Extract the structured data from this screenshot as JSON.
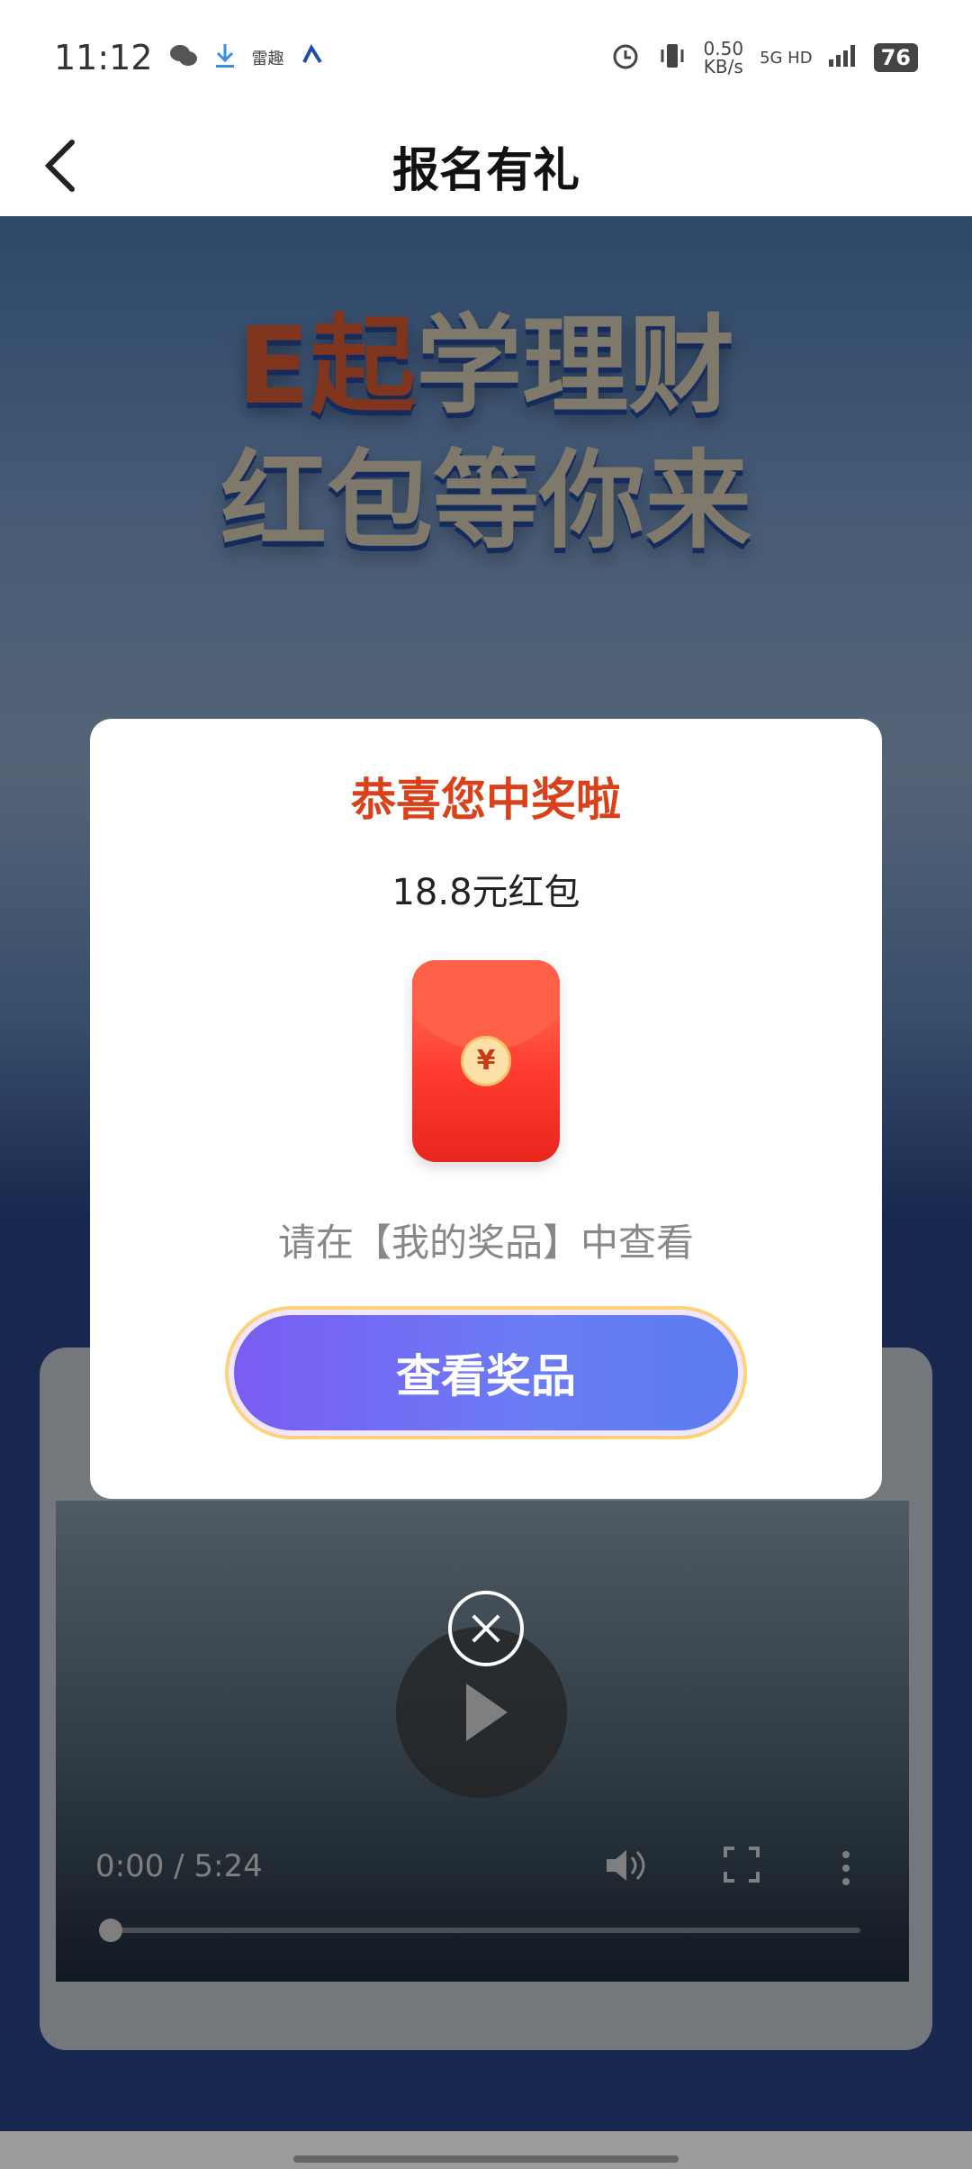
{
  "status_bar": {
    "time": "11:12",
    "app_label": "雷趣",
    "net_speed": "0.50",
    "net_unit": "KB/s",
    "signal": "5G HD",
    "battery": "76"
  },
  "nav": {
    "title": "报名有礼"
  },
  "hero": {
    "line1_accent": "E起",
    "line1_rest": "学理财",
    "line2": "红包等你来"
  },
  "video": {
    "time": "0:00 / 5:24",
    "progress": 0
  },
  "modal": {
    "title": "恭喜您中奖啦",
    "amount": "18.8元红包",
    "packet_symbol": "¥",
    "hint": "请在【我的奖品】中查看",
    "button": "查看奖品"
  },
  "colors": {
    "title_red": "#d9411a",
    "button_purple": "#6a7df5",
    "packet_red": "#ff3b2f"
  }
}
